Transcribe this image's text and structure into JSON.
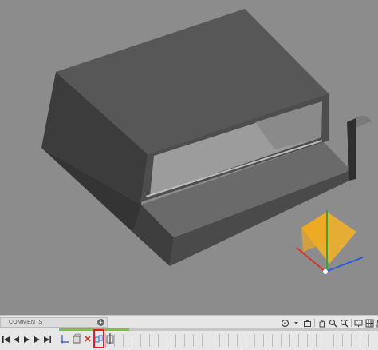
{
  "colors": {
    "viewport_background": "#8c8c8c",
    "model_top": "#555555",
    "model_front": "#3b3b3b",
    "model_side": "#474747",
    "opening_background": "#9a9a9a",
    "timeline_progress": "#7fc241",
    "highlight_box": "#e02020",
    "gizmo_x": "#d8332a",
    "gizmo_y": "#3aa23a",
    "gizmo_z": "#2c59d8",
    "gizmo_plane": "#f5b324"
  },
  "comments_panel": {
    "label": "COMMENTS",
    "add_icon": "plus-circle-icon"
  },
  "nav_toolbar": {
    "icons": [
      "orbit-icon",
      "dropdown-icon",
      "home-view-icon",
      "pan-icon",
      "zoom-icon",
      "zoom-fit-icon",
      "display-settings-icon",
      "grid-icon",
      "viewports-icon"
    ]
  },
  "playback": {
    "icons": [
      "first-step-icon",
      "previous-step-icon",
      "play-icon",
      "next-step-icon",
      "last-step-icon"
    ]
  },
  "timeline": {
    "progress_fraction": 0.22,
    "features": [
      "sketch-feature-icon",
      "extrude-feature-icon",
      "delete-feature-icon",
      "pattern-feature-icon",
      "selected-feature-icon"
    ]
  }
}
